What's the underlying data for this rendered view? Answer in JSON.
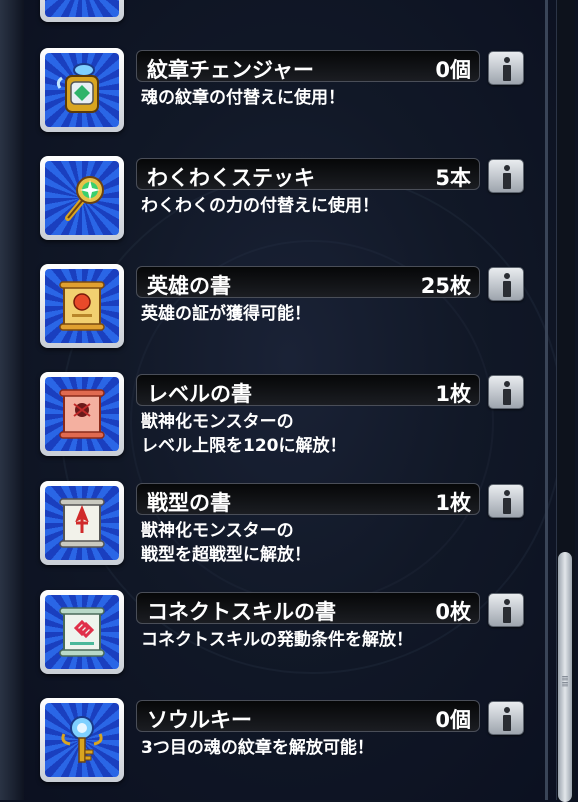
{
  "items": [
    {
      "name": "紋章チェンジャー",
      "count": "0個",
      "description": "魂の紋章の付替えに使用！",
      "icon": "crest-changer-icon"
    },
    {
      "name": "わくわくステッキ",
      "count": "5本",
      "description": "わくわくの力の付替えに使用！",
      "icon": "wakuwaku-stick-icon"
    },
    {
      "name": "英雄の書",
      "count": "25枚",
      "description": "英雄の証が獲得可能！",
      "icon": "hero-book-scroll-icon"
    },
    {
      "name": "レベルの書",
      "count": "1枚",
      "description": "獣神化モンスターの\nレベル上限を120に解放！",
      "icon": "level-book-scroll-icon"
    },
    {
      "name": "戦型の書",
      "count": "1枚",
      "description": "獣神化モンスターの\n戦型を超戦型に解放！",
      "icon": "combat-type-book-scroll-icon"
    },
    {
      "name": "コネクトスキルの書",
      "count": "0枚",
      "description": "コネクトスキルの発動条件を解放！",
      "icon": "connect-skill-book-scroll-icon"
    },
    {
      "name": "ソウルキー",
      "count": "0個",
      "description": "3つ目の魂の紋章を解放可能！",
      "icon": "soul-key-icon"
    }
  ],
  "info_button_icon": "info-icon",
  "colors": {
    "icon_bg_dark": "#1a3fbf",
    "icon_bg_light": "#2a66e6",
    "name_bar": "#0a0b0d"
  }
}
